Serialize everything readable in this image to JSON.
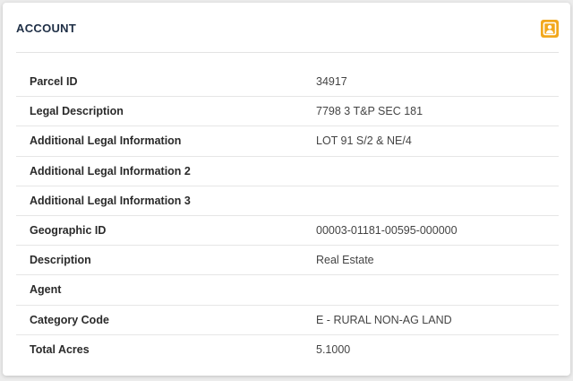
{
  "card": {
    "title": "ACCOUNT",
    "icon": "user-icon",
    "accent_color": "#f2a81d"
  },
  "rows": [
    {
      "label": "Parcel ID",
      "value": "34917"
    },
    {
      "label": "Legal Description",
      "value": "7798 3 T&P SEC 181"
    },
    {
      "label": "Additional Legal Information",
      "value": "LOT 91 S/2 & NE/4"
    },
    {
      "label": "Additional Legal Information 2",
      "value": ""
    },
    {
      "label": "Additional Legal Information 3",
      "value": ""
    },
    {
      "label": "Geographic ID",
      "value": "00003-01181-00595-000000"
    },
    {
      "label": "Description",
      "value": "Real Estate"
    },
    {
      "label": "Agent",
      "value": ""
    },
    {
      "label": "Category Code",
      "value": "E - RURAL NON-AG LAND"
    },
    {
      "label": "Total Acres",
      "value": "5.1000"
    }
  ]
}
